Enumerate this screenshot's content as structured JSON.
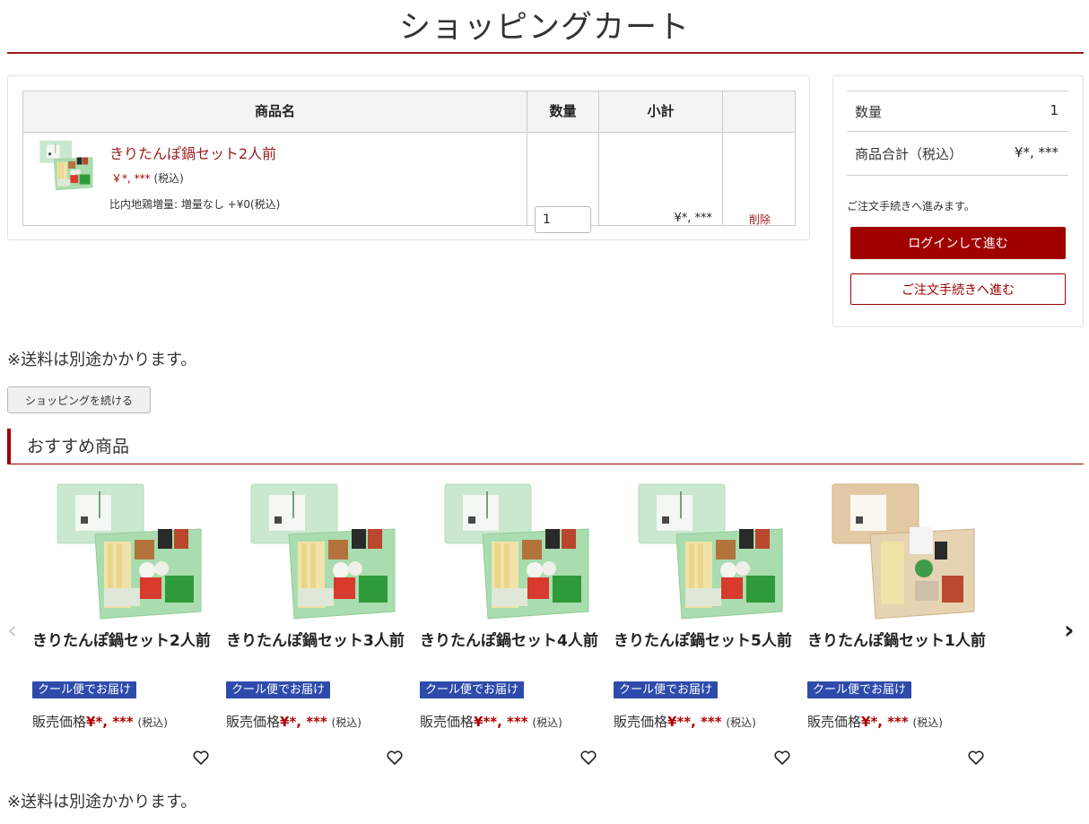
{
  "page": {
    "title": "ショッピングカート"
  },
  "cart": {
    "headers": {
      "name": "商品名",
      "qty": "数量",
      "subtotal": "小計",
      "action": ""
    },
    "item": {
      "name": "きりたんぽ鍋セット2人前",
      "price": "￥*, ***",
      "tax": "(税込)",
      "option": "比内地鶏増量: 増量なし +¥0(税込)",
      "qty": "1",
      "subtotal": "¥*, ***",
      "delete_label": "削除"
    }
  },
  "summary": {
    "qty_label": "数量",
    "qty_value": "1",
    "total_label": "商品合計（税込）",
    "total_value": "¥*, ***",
    "note": "ご注文手続きへ進みます。",
    "login_button": "ログインして進む",
    "guest_button": "ご注文手続きへ進む"
  },
  "shipping_note": "※送料は別途かかります。",
  "continue_button": "ショッピングを続ける",
  "recommend": {
    "title": "おすすめ商品",
    "badge": "クール便でお届け",
    "price_label": "販売価格",
    "tax": "(税込)",
    "items": [
      {
        "name": "きりたんぽ鍋セット2人前",
        "price": "¥*, ***"
      },
      {
        "name": "きりたんぽ鍋セット3人前",
        "price": "¥*, ***"
      },
      {
        "name": "きりたんぽ鍋セット4人前",
        "price": "¥**, ***"
      },
      {
        "name": "きりたんぽ鍋セット5人前",
        "price": "¥**, ***"
      },
      {
        "name": "きりたんぽ鍋セット1人前",
        "price": "¥*, ***"
      }
    ]
  },
  "icons": {
    "prev": "chevron-left-icon",
    "next": "chevron-right-icon",
    "favorite": "heart-icon"
  },
  "colors": {
    "accent": "#a00000",
    "badge": "#2e4bac",
    "link": "#9b1b1b"
  }
}
